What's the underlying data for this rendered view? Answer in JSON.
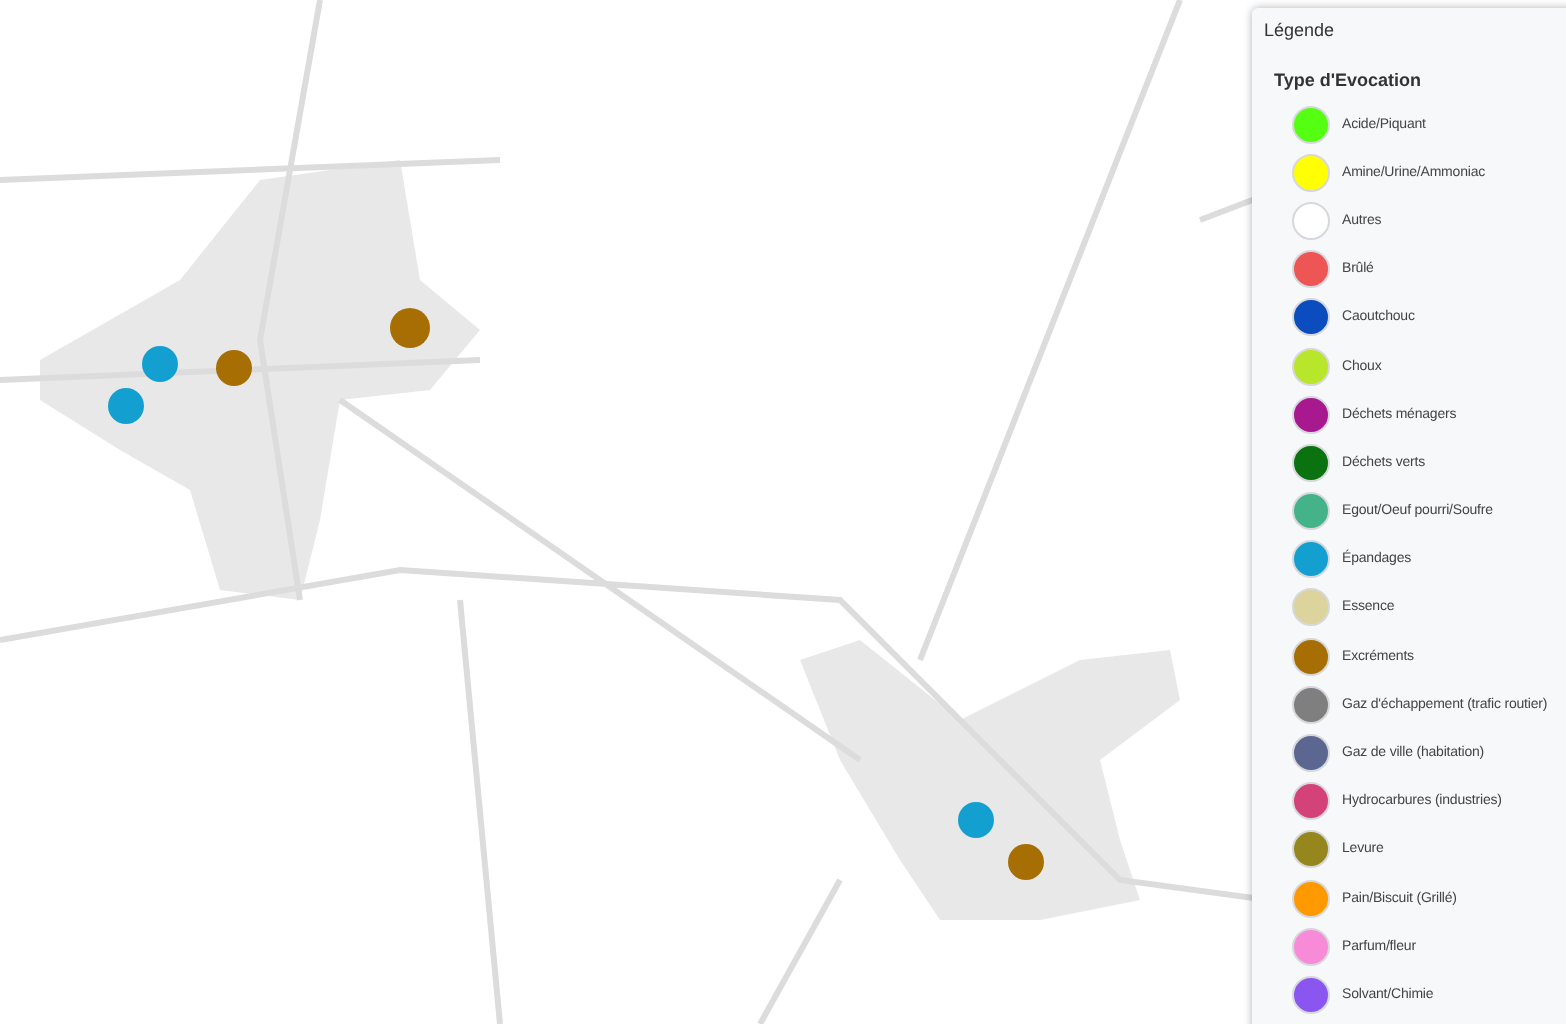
{
  "legend": {
    "title": "Légende",
    "group_title": "Type d'Evocation",
    "items": [
      {
        "label": "Acide/Piquant",
        "color": "#55ff11"
      },
      {
        "label": "Amine/Urine/Ammoniac",
        "color": "#ffff00"
      },
      {
        "label": "Autres",
        "color": "#ffffff"
      },
      {
        "label": "Brûlé",
        "color": "#ee5555"
      },
      {
        "label": "Caoutchouc",
        "color": "#0b4cbf"
      },
      {
        "label": "Choux",
        "color": "#b7e62a"
      },
      {
        "label": "Déchets ménagers",
        "color": "#a8198f"
      },
      {
        "label": "Déchets verts",
        "color": "#0a7310"
      },
      {
        "label": "Egout/Oeuf pourri/Soufre",
        "color": "#45b38a"
      },
      {
        "label": "Épandages",
        "color": "#13a0d1"
      },
      {
        "label": "Essence",
        "color": "#dcd49c"
      },
      {
        "label": "Excréments",
        "color": "#a76e04"
      },
      {
        "label": "Gaz d'échappement (trafic routier)",
        "color": "#7f7f7f"
      },
      {
        "label": "Gaz de ville (habitation)",
        "color": "#5b6790"
      },
      {
        "label": "Hydrocarbures (industries)",
        "color": "#d4427a"
      },
      {
        "label": "Levure",
        "color": "#95871d"
      },
      {
        "label": "Pain/Biscuit (Grillé)",
        "color": "#ff9900"
      },
      {
        "label": "Parfum/fleur",
        "color": "#f78bd8"
      },
      {
        "label": "Solvant/Chimie",
        "color": "#8b56f0"
      }
    ]
  }
}
